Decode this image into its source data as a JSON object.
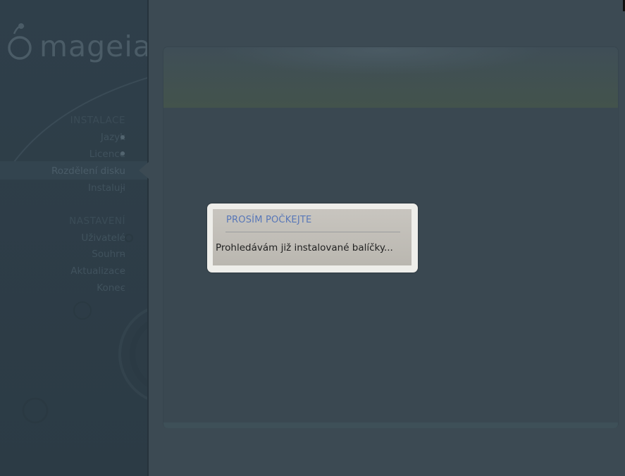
{
  "sidebar": {
    "logo_text": "mageia",
    "sections": [
      {
        "title": "INSTALACE",
        "items": [
          {
            "label": "Jazyk",
            "state": "done"
          },
          {
            "label": "Licence",
            "state": "done"
          },
          {
            "label": "Rozdělení disku",
            "state": "active"
          },
          {
            "label": "Instaluji",
            "state": "todo"
          }
        ]
      },
      {
        "title": "NASTAVENÍ",
        "items": [
          {
            "label": "Uživatelé",
            "state": "todo"
          },
          {
            "label": "Souhrn",
            "state": "todo"
          },
          {
            "label": "Aktualizace",
            "state": "todo"
          },
          {
            "label": "Konec",
            "state": "todo"
          }
        ]
      }
    ]
  },
  "dialog": {
    "title": "PROSÍM POČKEJTE",
    "message": "Prohledávám již instalované balíčky..."
  },
  "colors": {
    "background": "#3c4a53",
    "sidebar": "#2f3f4a",
    "dialog_title": "#5877b8",
    "dialog_body": "#c2bfb9"
  }
}
